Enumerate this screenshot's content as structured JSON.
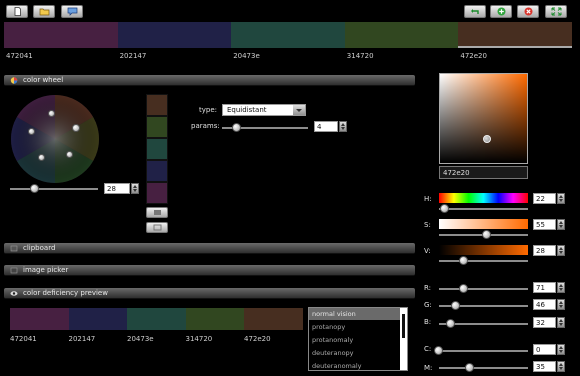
{
  "toolbar": {
    "left_icons": [
      "new-file-icon",
      "open-folder-icon",
      "comment-icon"
    ],
    "right_icons": [
      "undo-icon",
      "add-icon",
      "remove-icon",
      "fullscreen-icon"
    ]
  },
  "palette": [
    {
      "hex": "472041",
      "color": "#472041"
    },
    {
      "hex": "202147",
      "color": "#202147"
    },
    {
      "hex": "20473e",
      "color": "#20473e"
    },
    {
      "hex": "314720",
      "color": "#314720"
    },
    {
      "hex": "472e20",
      "color": "#472e20"
    }
  ],
  "color_wheel": {
    "title": "color wheel",
    "brightness_value": "28",
    "type_label": "type:",
    "type_value": "Equidistant",
    "params_label": "params:",
    "params_value": "4",
    "stack_colors": [
      "#472e20",
      "#314720",
      "#20473e",
      "#202147",
      "#472041"
    ]
  },
  "panels": {
    "clipboard": "clipboard",
    "image_picker": "image picker",
    "color_deficiency": "color deficiency preview"
  },
  "deficiency": {
    "list": [
      "normal vision",
      "protanopy",
      "protanomaly",
      "deuteranopy",
      "deuteranomaly"
    ],
    "selected": "normal vision"
  },
  "picker": {
    "hex": "472e20",
    "h_label": "H:",
    "h_value": "22",
    "s_label": "S:",
    "s_value": "55",
    "v_label": "V:",
    "v_value": "28",
    "r_label": "R:",
    "r_value": "71",
    "g_label": "G:",
    "g_value": "46",
    "b_label": "B:",
    "b_value": "32",
    "c_label": "C:",
    "c_value": "0",
    "m_label": "M:",
    "m_value": "35",
    "accent": "#ff6a00"
  }
}
